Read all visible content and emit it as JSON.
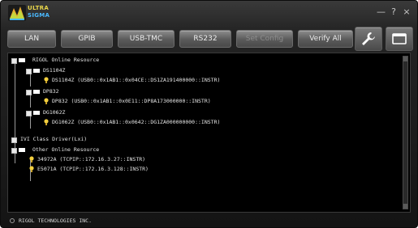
{
  "app": {
    "logo_line1": "ULTRA",
    "logo_line2": "SIGMA",
    "controls": {
      "minimize": "—",
      "help": "?",
      "close": "×"
    }
  },
  "toolbar": {
    "buttons": [
      {
        "label": "LAN",
        "enabled": true
      },
      {
        "label": "GPIB",
        "enabled": true
      },
      {
        "label": "USB-TMC",
        "enabled": true
      },
      {
        "label": "RS232",
        "enabled": true
      },
      {
        "label": "Set Config",
        "enabled": false
      },
      {
        "label": "Verify All",
        "enabled": true
      }
    ],
    "icons": [
      "wrench-icon",
      "window-icon"
    ]
  },
  "tree": {
    "root": "RIGOL Online Resource",
    "devices": [
      {
        "model": "DS1104Z",
        "resource": "DS1104Z (USB0::0x1AB1::0x04CE::DS1ZA191400000::INSTR)"
      },
      {
        "model": "DP832",
        "resource": "DP832 (USB0::0x1AB1::0x0E11::DP8A173000000::INSTR)"
      },
      {
        "model": "DG1062Z",
        "resource": "DG1062Z (USB0::0x1AB1::0x0642::DG1ZA000000000::INSTR)"
      }
    ],
    "driver_node": "IVI Class Driver(Lxi)",
    "other_root": "Other Online Resource",
    "other_items": [
      "34972A (TCPIP::172.16.3.27::INSTR)",
      "E5071A (TCPIP::172.16.3.128::INSTR)"
    ]
  },
  "status": {
    "text": "RIGOL TECHNOLOGIES INC."
  },
  "colors": {
    "bulb": "#f4d03f",
    "folder": "#ffffff",
    "panel_bg": "#000000"
  }
}
